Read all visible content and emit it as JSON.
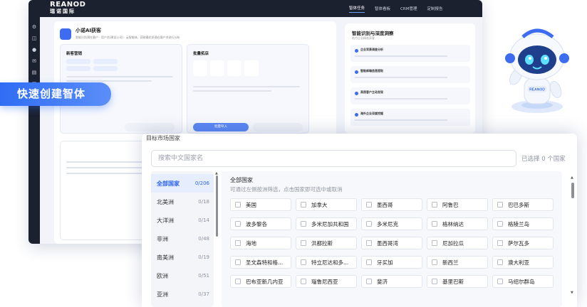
{
  "app": {
    "logo_en": "REANOD",
    "logo_cn": "瑞诺国际",
    "nav": [
      "智体任务",
      "智体看板",
      "CRM管理",
      "定制报告"
    ],
    "page_title": "小诺AI获客",
    "page_subtitle": "智能识别潜在客户 · 用户名(建设公司) · 云智能体，获取最优质潜在客户并进行分析",
    "card1_title": "新客营销",
    "card2_title": "批量拓店",
    "btn_import": "批量导入",
    "insight_title": "智能识别与深度洞察",
    "insight_subtitle": "助力企业精准获客",
    "insight_items": [
      "企业背景调查分析",
      "智能邮箱信息提取",
      "高质客户主动发现",
      "海外企业深度挖掘"
    ]
  },
  "badge": "快速创建智体",
  "popup": {
    "title": "目标市场国家",
    "search_placeholder": "搜索中文国家名",
    "selected_count": "已选择 0 个国家",
    "panel_title": "全部国家",
    "panel_hint": "可通过左侧按洲筛选，点击国家即可选中或取消",
    "regions": [
      {
        "name": "全部国家",
        "count": "0/206",
        "active": true
      },
      {
        "name": "北美洲",
        "count": "0/18",
        "active": false
      },
      {
        "name": "大洋洲",
        "count": "0/14",
        "active": false
      },
      {
        "name": "非洲",
        "count": "0/48",
        "active": false
      },
      {
        "name": "南美洲",
        "count": "0/19",
        "active": false
      },
      {
        "name": "欧洲",
        "count": "0/51",
        "active": false
      },
      {
        "name": "亚洲",
        "count": "0/37",
        "active": false
      }
    ],
    "countries": [
      [
        "美国",
        "加拿大",
        "墨西哥",
        "阿鲁巴",
        "巴巴多斯"
      ],
      [
        "波多黎各",
        "多米尼加共和国",
        "多米尼克",
        "格林纳达",
        "格陵兰岛"
      ],
      [
        "海地",
        "洪都拉斯",
        "墨西哥湾",
        "尼加拉瓜",
        "萨尔瓦多"
      ],
      [
        "圣文森特和格...",
        "特立尼达和多...",
        "牙买加",
        "新西兰",
        "澳大利亚"
      ],
      [
        "巴布亚新几内亚",
        "瑙鲁尼西亚",
        "斐济",
        "基里巴斯",
        "马绍尔群岛"
      ]
    ]
  }
}
